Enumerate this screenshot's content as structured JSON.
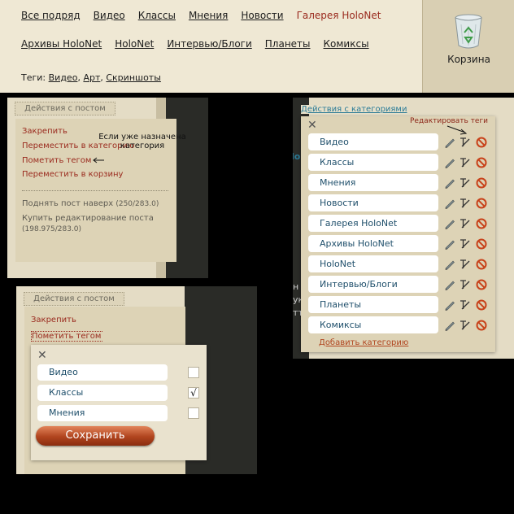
{
  "nav": {
    "row1": [
      "Все подряд",
      "Видео",
      "Классы",
      "Мнения",
      "Новости",
      "Галерея HoloNet"
    ],
    "row2": [
      "Архивы HoloNet",
      "HoloNet",
      "Интервью/Блоги",
      "Планеты",
      "Комиксы"
    ],
    "active": "Галерея HoloNet"
  },
  "tags": {
    "prefix": "Теги:",
    "items": [
      "Видео",
      "Арт",
      "Скриншоты"
    ]
  },
  "trash": {
    "label": "Корзина",
    "icon": "recycle-bin-icon"
  },
  "panel_a": {
    "button": "Действия с постом",
    "menu": [
      "Закрепить",
      "Переместить в категорию",
      "Пометить тегом",
      "Переместить в корзину"
    ],
    "gray_items": [
      {
        "label": "Поднять пост наверх",
        "note": "(250/283.0)"
      },
      {
        "label": "Купить редактирование поста",
        "note": "(198.975/283.0)"
      }
    ],
    "annotation": "Если уже назначена категория"
  },
  "panel_b": {
    "button": "Действия с постом",
    "menu": [
      "Закрепить",
      "Пометить тегом"
    ],
    "tags": [
      {
        "label": "Видео",
        "checked": false
      },
      {
        "label": "Классы",
        "checked": true
      },
      {
        "label": "Мнения",
        "checked": false
      }
    ],
    "check_mark": "√",
    "save": "Сохранить",
    "close": "✕"
  },
  "panel_c": {
    "link": "Действия с категориями",
    "annotation": "Редактировать теги",
    "categories": [
      "Видео",
      "Классы",
      "Мнения",
      "Новости",
      "Галерея HoloNet",
      "Архивы HoloNet",
      "HoloNet",
      "Интервью/Блоги",
      "Планеты",
      "Комиксы"
    ],
    "add": "Добавить категорию",
    "close": "✕",
    "side_letters": [
      "lo",
      "н",
      "ук",
      "тт"
    ]
  },
  "colors": {
    "accent": "#9a2a1e",
    "link": "#2a7a96",
    "panel": "#ddd3b6",
    "dark": "#2a2b27"
  }
}
